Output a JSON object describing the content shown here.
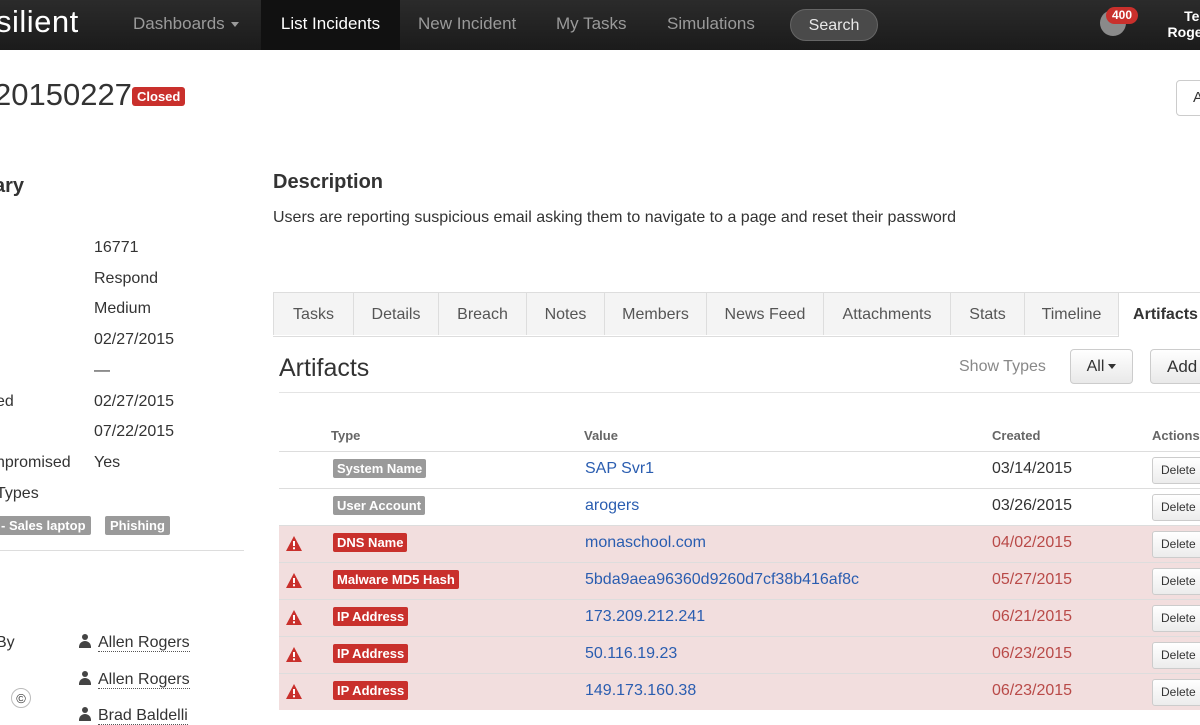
{
  "navbar": {
    "brand": "silient",
    "items": [
      {
        "label": "Dashboards"
      },
      {
        "label": "List Incidents"
      },
      {
        "label": "New Incident"
      },
      {
        "label": "My Tasks"
      },
      {
        "label": "Simulations"
      }
    ],
    "search_label": "Search",
    "notification_count": "400",
    "user_first": "Ted",
    "user_last": "Roger"
  },
  "incident": {
    "id": "20150227",
    "status": "Closed",
    "top_right_button": "A"
  },
  "summary": {
    "title": "ary",
    "fields": [
      {
        "label": "",
        "value": "16771"
      },
      {
        "label": "",
        "value": "Respond"
      },
      {
        "label": "",
        "value": "Medium"
      },
      {
        "label": "",
        "value": "02/27/2015"
      },
      {
        "label": "",
        "value": "—"
      },
      {
        "label": "ed",
        "value": "02/27/2015"
      },
      {
        "label": "",
        "value": "07/22/2015"
      },
      {
        "label": "npromised",
        "value": "Yes"
      },
      {
        "label": "Types",
        "value": ""
      }
    ],
    "tags": [
      "- Sales laptop",
      "Phishing"
    ],
    "people_label": "By",
    "people": [
      "Allen Rogers",
      "Allen Rogers",
      "Brad Baldelli"
    ]
  },
  "description": {
    "title": "Description",
    "text": "Users are reporting suspicious email asking them to navigate to a page and reset their password"
  },
  "tabs": [
    "Tasks",
    "Details",
    "Breach",
    "Notes",
    "Members",
    "News Feed",
    "Attachments",
    "Stats",
    "Timeline",
    "Artifacts"
  ],
  "artifacts": {
    "title": "Artifacts",
    "show_types_label": "Show Types",
    "filter_value": "All",
    "add_label": "Add",
    "columns": {
      "type": "Type",
      "value": "Value",
      "created": "Created",
      "actions": "Actions"
    },
    "delete_label": "Delete",
    "rows": [
      {
        "type": "System Name",
        "value": "SAP Svr1",
        "created": "03/14/2015",
        "alert": false
      },
      {
        "type": "User Account",
        "value": "arogers",
        "created": "03/26/2015",
        "alert": false
      },
      {
        "type": "DNS Name",
        "value": "monaschool.com",
        "created": "04/02/2015",
        "alert": true
      },
      {
        "type": "Malware MD5 Hash",
        "value": "5bda9aea96360d9260d7cf38b416af8c",
        "created": "05/27/2015",
        "alert": true
      },
      {
        "type": "IP Address",
        "value": "173.209.212.241",
        "created": "06/21/2015",
        "alert": true
      },
      {
        "type": "IP Address",
        "value": "50.116.19.23",
        "created": "06/23/2015",
        "alert": true
      },
      {
        "type": "IP Address",
        "value": "149.173.160.38",
        "created": "06/23/2015",
        "alert": true
      }
    ]
  },
  "colors": {
    "alert_label": "#c9302c",
    "normal_label": "#9a9a9a",
    "alert_row": "#f2dede",
    "link": "#2a5db0"
  },
  "icons": {
    "copyright": "©"
  }
}
